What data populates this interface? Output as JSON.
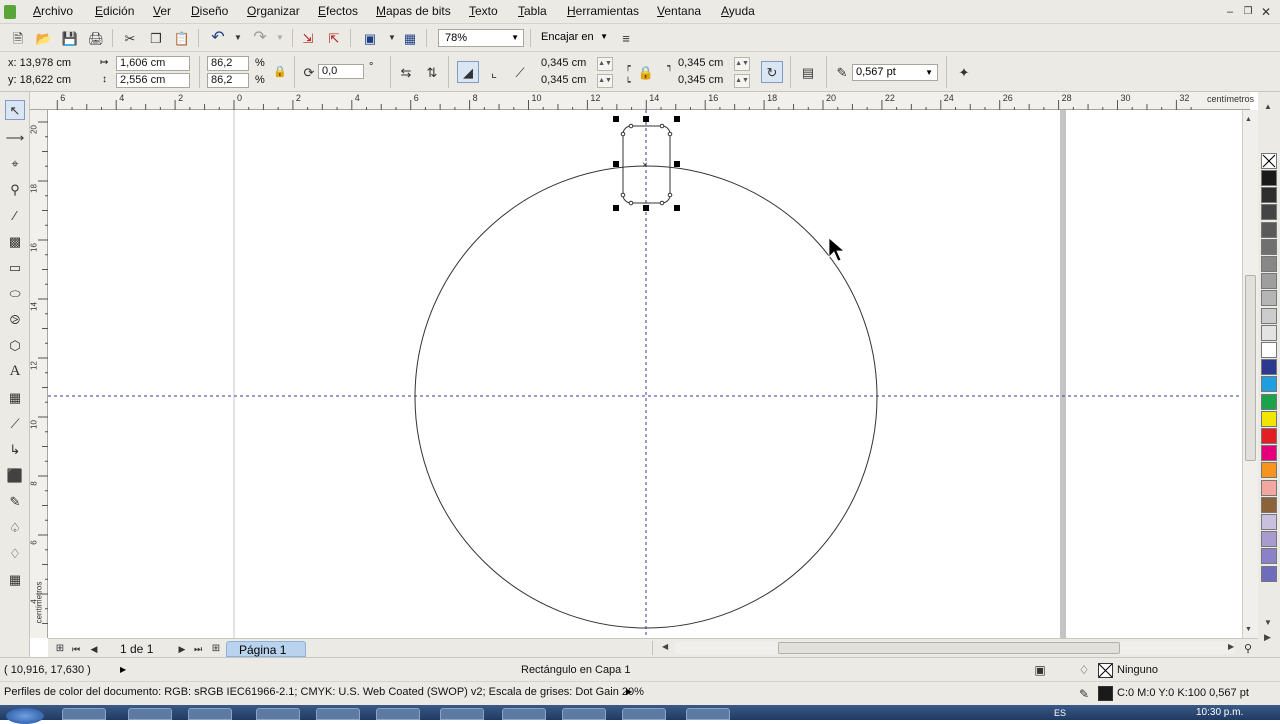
{
  "menu": [
    "Archivo",
    "Edición",
    "Ver",
    "Diseño",
    "Organizar",
    "Efectos",
    "Mapas de bits",
    "Texto",
    "Tabla",
    "Herramientas",
    "Ventana",
    "Ayuda"
  ],
  "toolbar": {
    "zoom": "78%",
    "snap": "Encajar en"
  },
  "props": {
    "x": "x: 13,978 cm",
    "y": "y: 18,622 cm",
    "width": "1,606 cm",
    "height": "2,556 cm",
    "scale_x": "86,2",
    "scale_y": "86,2",
    "percent": "%",
    "rotation": "0,0",
    "degree": "°",
    "corner_tl": "0,345 cm",
    "corner_bl": "0,345 cm",
    "corner_tr": "0,345 cm",
    "corner_br": "0,345 cm",
    "outline": "0,567 pt"
  },
  "ruler": {
    "top_labels": [
      "6",
      "4",
      "2",
      "0",
      "2",
      "4",
      "6",
      "8",
      "10",
      "12",
      "14",
      "16",
      "18",
      "20",
      "22",
      "24",
      "26",
      "28",
      "30",
      "32"
    ],
    "unit": "centímetros",
    "left_labels": [
      "20",
      "18",
      "16",
      "14",
      "12",
      "10",
      "8",
      "6",
      "4"
    ]
  },
  "pagebar": {
    "page_count": "1 de 1",
    "page_tab": "Página 1"
  },
  "status": {
    "coords": "( 10,916, 17,630 )",
    "object": "Rectángulo en Capa 1",
    "fill": "Ninguno",
    "outline_info": "C:0 M:0 Y:0 K:100  0,567 pt",
    "color_profile": "Perfiles de color del documento: RGB: sRGB IEC61966-2.1; CMYK: U.S. Web Coated (SWOP) v2; Escala de grises: Dot Gain 20%"
  },
  "taskbar": {
    "clock": "10:30 p.m.",
    "lang": "ES"
  },
  "palette_colors": [
    "#1a1a1a",
    "#2e2e2e",
    "#444444",
    "#5a5a5a",
    "#707070",
    "#878787",
    "#9e9e9e",
    "#b5b5b5",
    "#cccccc",
    "#e3e3e3",
    "#ffffff",
    "#2b3a8f",
    "#1e9fe0",
    "#1aa34a",
    "#f2e600",
    "#e31e24",
    "#e3007a",
    "#f7941d",
    "#f4a6a0",
    "#8c6239",
    "#c9c0e0",
    "#a79bd0",
    "#8a82c8",
    "#6f6bbd"
  ],
  "colors": {
    "chrome": "#eceae5",
    "guide": "#3a3aa0",
    "page_tab": "#b9d3ee"
  }
}
